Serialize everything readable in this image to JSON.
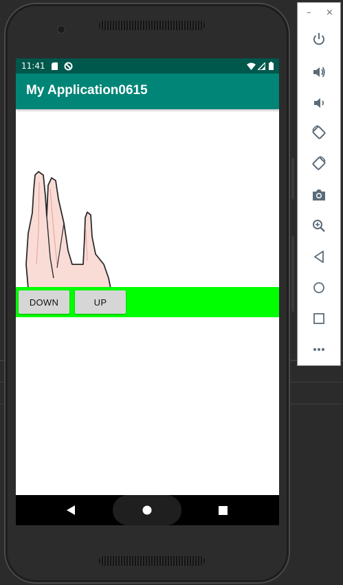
{
  "status_bar": {
    "time": "11:41",
    "icons": [
      "sd-card-icon",
      "sync-blocked-icon",
      "wifi-icon",
      "signal-icon",
      "battery-icon"
    ]
  },
  "app_bar": {
    "title": "My Application0615"
  },
  "content": {
    "image": "hand-fingers-image",
    "buttons": {
      "down_label": "DOWN",
      "up_label": "UP"
    }
  },
  "nav_bar": {
    "icons": [
      "back-icon",
      "home-icon",
      "recents-icon"
    ]
  },
  "emulator_toolbar": {
    "window_controls": {
      "minimize": "–",
      "close": "×"
    },
    "actions": [
      "power",
      "volume-up",
      "volume-down",
      "rotate-left",
      "rotate-right",
      "screenshot",
      "zoom",
      "back",
      "home",
      "overview",
      "more"
    ]
  },
  "colors": {
    "status_bar": "#00574b",
    "app_bar": "#008577",
    "button_strip": "#00ff00",
    "button": "#d6d6d6",
    "nav_bar": "#000000",
    "toolbar_icon": "#5b6b79"
  }
}
